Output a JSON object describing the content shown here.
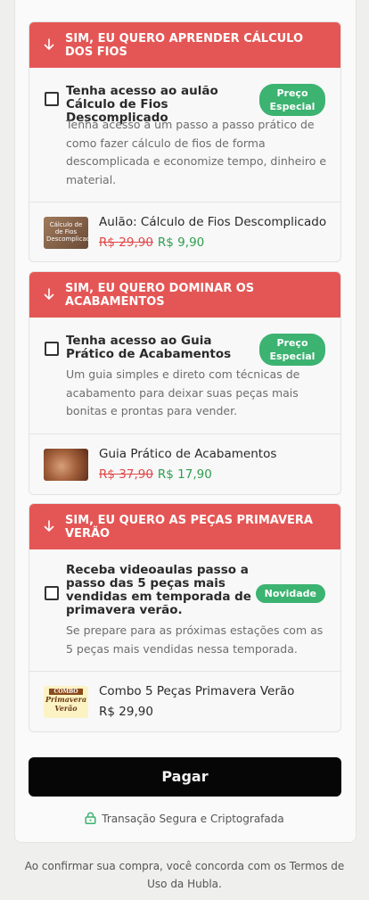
{
  "offers": [
    {
      "header": "SIM, EU QUERO APRENDER CÁLCULO DOS FIOS",
      "title": "Tenha acesso ao aulão Cálculo de Fios Descomplicado",
      "badge": "Preço Especial",
      "description": "Tenha acesso à um passo a passo prático de como fazer cálculo de fios de forma descomplicada e economize tempo, dinheiro e material.",
      "product_name": "Aulão: Cálculo de Fios Descomplicado",
      "old_price": "R$ 29,90",
      "new_price": "R$ 9,90",
      "thumb_text": "Cálculo de de Fios Descomplicado",
      "checked": false
    },
    {
      "header": "SIM, EU QUERO DOMINAR OS ACABAMENTOS",
      "title": "Tenha acesso ao Guia Prático de Acabamentos",
      "badge": "Preço Especial",
      "description": "Um guia simples e direto com técnicas de acabamento para deixar suas peças mais bonitas e prontas para vender.",
      "product_name": "Guia Prático de Acabamentos",
      "old_price": "R$ 37,90",
      "new_price": "R$ 17,90",
      "checked": false
    },
    {
      "header": "SIM, EU QUERO AS PEÇAS PRIMAVERA VERÃO",
      "title": "Receba videoaulas passo a passo das 5 peças mais vendidas em temporada de primavera verão.",
      "badge": "Novidade",
      "description": "Se prepare para as próximas estações com as 5 peças mais vendidas nessa temporada.",
      "product_name": "Combo 5 Peças Primavera Verão",
      "price": "R$ 29,90",
      "thumb_text": [
        "COMBO",
        "Primavera",
        "Verão"
      ],
      "checked": false
    }
  ],
  "pay_button": "Pagar",
  "secure_text": "Transação Segura e Criptografada",
  "terms_text": "Ao confirmar sua compra, você concorda com os Termos de Uso da Hubla.",
  "colors": {
    "header_red": "#e45655",
    "badge_green": "#3cb371",
    "old_price": "#e04848",
    "new_price": "#2e9e4f",
    "pay_button": "#060606"
  }
}
